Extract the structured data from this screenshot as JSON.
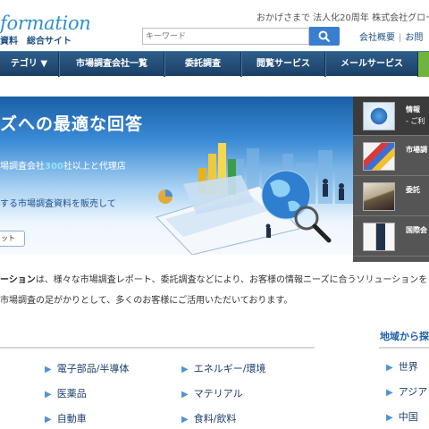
{
  "header": {
    "logo_text": "formation",
    "subtitle": "資料　総合サイト",
    "tagline": "おかげさまで 法人化20周年 株式会社グロー",
    "search": {
      "placeholder": "キーワード"
    },
    "links": [
      "会社概要",
      "お問"
    ]
  },
  "nav": {
    "items": [
      "テゴリ ▼",
      "市場調査会社一覧",
      "委託調査",
      "閲覧サービス",
      "メールサービス"
    ]
  },
  "hero": {
    "title": "ズへの最適な回答",
    "line1_prefix": "場調査会社",
    "line1_highlight": "300",
    "line1_suffix": "社以上と代理店",
    "line2": "する市場調査資料を販売して",
    "button_label": "ット"
  },
  "side_menu": {
    "items": [
      {
        "label": "情報",
        "sub": "- ご利"
      },
      {
        "label": "市場調",
        "sub": ""
      },
      {
        "label": "委託",
        "sub": ""
      },
      {
        "label": "国際会",
        "sub": ""
      }
    ]
  },
  "intro": {
    "bold": "ーション",
    "text1": "は、様々な市場調査レポート、委託調査などにより、お客様の情報ニーズに合うソリューションを",
    "text2": "市場調査の足がかりとして、多くのお客様にご活用いただいております。"
  },
  "categories": {
    "col1": [
      "電子部品/半導体",
      "医薬品",
      "自動車"
    ],
    "col2": [
      "エネルギー/環境",
      "マテリアル",
      "食料/飲料"
    ]
  },
  "regions": {
    "title": "地域から探",
    "items": [
      "世界",
      "アジア",
      "中国"
    ]
  },
  "colors": {
    "nav_bg": "#1b3f66",
    "accent": "#3a7fcf",
    "highlight": "#8fe3ff",
    "nav_green": "#6fb43f"
  }
}
